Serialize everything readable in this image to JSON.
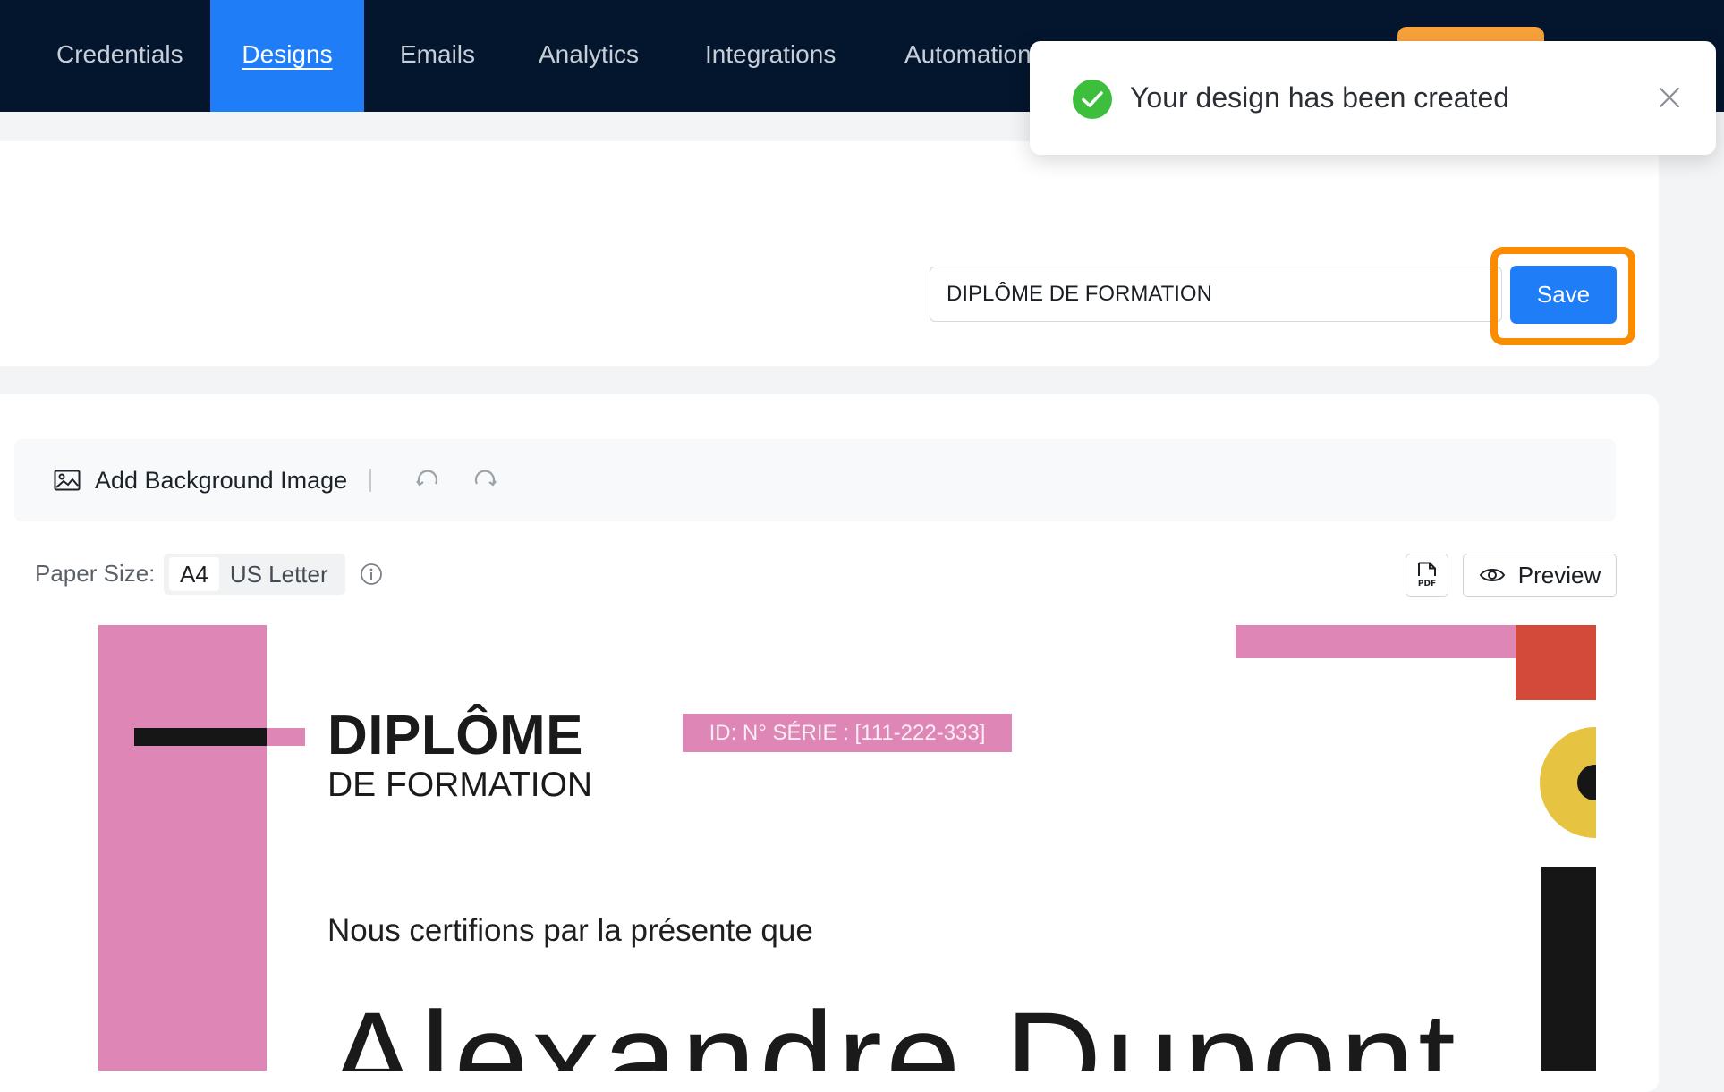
{
  "nav": {
    "tabs": [
      {
        "label": "Credentials"
      },
      {
        "label": "Designs"
      },
      {
        "label": "Emails"
      },
      {
        "label": "Analytics"
      },
      {
        "label": "Integrations"
      },
      {
        "label": "Automation"
      }
    ],
    "active_tab": "Designs"
  },
  "design": {
    "name_value": "DIPLÔME DE FORMATION",
    "save_label": "Save"
  },
  "toolbar": {
    "add_background_label": "Add Background Image",
    "icons": [
      "image-icon",
      "undo-icon",
      "redo-icon"
    ]
  },
  "paper": {
    "label": "Paper Size:",
    "options": [
      "A4",
      "US Letter"
    ],
    "selected": "A4"
  },
  "actions": {
    "pdf_icon_text": "PDF",
    "preview_label": "Preview"
  },
  "certificate": {
    "title": "DIPLÔME",
    "subtitle": "DE FORMATION",
    "serial": "ID: N° SÉRIE : [111-222-333]",
    "certify_text": "Nous certifions par la présente que",
    "recipient": "Alexandre Dupont"
  },
  "toast": {
    "message": "Your design has been created"
  },
  "colors": {
    "nav_bg": "#04162d",
    "accent_blue": "#1f7ef7",
    "highlight_orange": "#fb8c00",
    "success_green": "#3dbf3d",
    "cert_pink": "#de86b5",
    "cert_red": "#d44a3a",
    "cert_yellow": "#e6c340"
  }
}
